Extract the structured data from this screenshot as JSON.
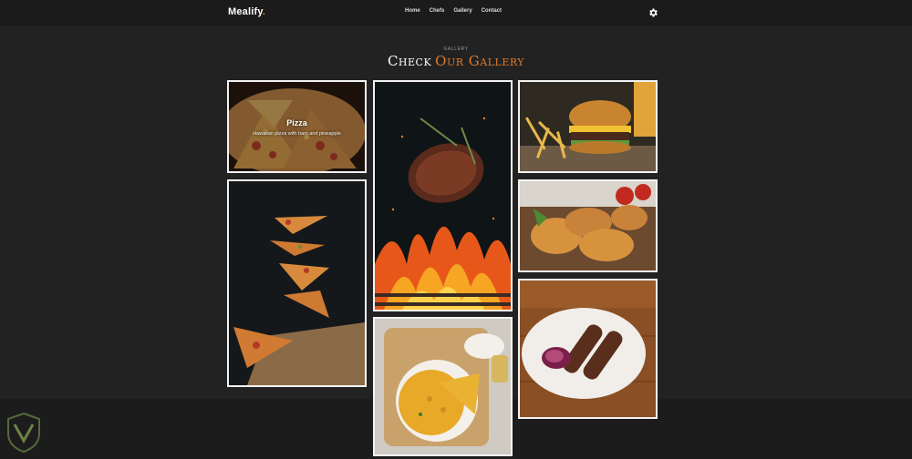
{
  "header": {
    "logo_text": "Mealify",
    "logo_dot": ".",
    "nav": [
      "Home",
      "Chefs",
      "Gallery",
      "Contact"
    ],
    "settings_icon": "gear-icon"
  },
  "section": {
    "label": "GALLERY",
    "title_part1": "Check",
    "title_part2": "Our Gallery"
  },
  "gallery": {
    "featured": {
      "title": "Pizza",
      "description": "Hawaiian pizza with ham and pineapple"
    },
    "images": [
      "pizza-slices-photo",
      "flying-pizza-slices-photo",
      "grilled-steak-flames-photo",
      "omelette-plate-photo",
      "burger-fries-photo",
      "fried-chicken-photo",
      "kebab-plate-photo"
    ]
  },
  "colors": {
    "accent": "#e07a2a",
    "background": "#222222",
    "header": "#1b1b1b"
  }
}
